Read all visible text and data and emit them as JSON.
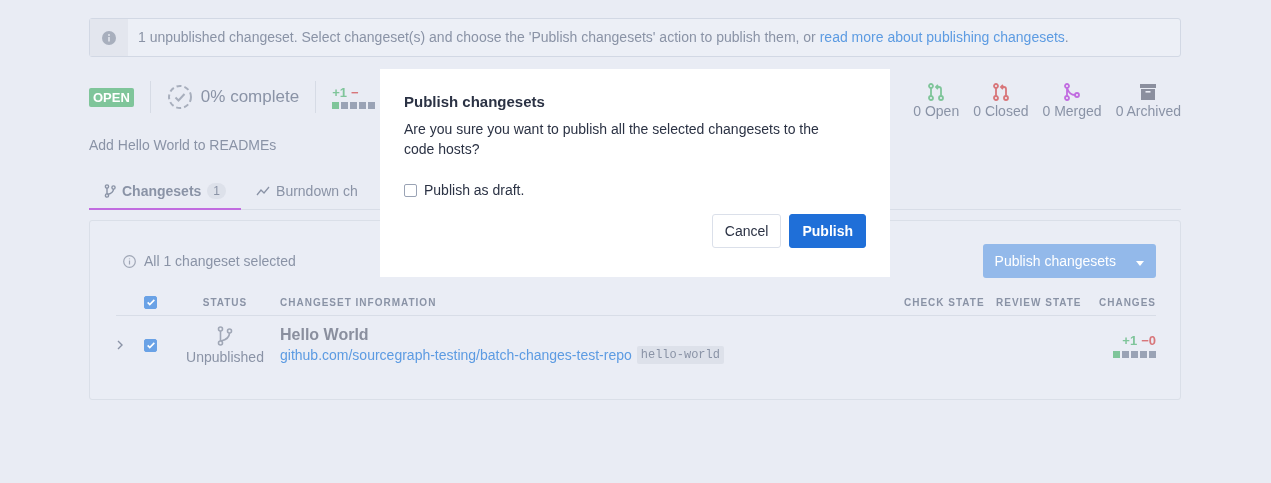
{
  "banner": {
    "text": "1 unpublished changeset. Select changeset(s) and choose the 'Publish changesets' action to publish them, or ",
    "link": "read more about publishing changesets",
    "end": "."
  },
  "stats": {
    "state_badge": "OPEN",
    "progress": "0% complete",
    "diff": {
      "added": "+1",
      "removed": "−"
    },
    "counts": [
      {
        "kind": "open",
        "label": "0 Open"
      },
      {
        "kind": "closed",
        "label": "0 Closed"
      },
      {
        "kind": "merged",
        "label": "0 Merged"
      },
      {
        "kind": "archived",
        "label": "0 Archived"
      }
    ]
  },
  "description": "Add Hello World to READMEs",
  "tabs": [
    {
      "kind": "changesets",
      "label": "Changesets",
      "count": "1",
      "selected": true
    },
    {
      "kind": "chart",
      "label": "Burndown ch",
      "selected": false
    }
  ],
  "panel": {
    "selection_note": "All 1 changeset selected",
    "action_button": {
      "label": "Publish changesets",
      "disabled": true
    },
    "table": {
      "select_all_checked": true,
      "columns": [
        "STATUS",
        "CHANGESET INFORMATION",
        "CHECK STATE",
        "REVIEW STATE",
        "CHANGES"
      ],
      "rows": [
        {
          "expanded": false,
          "checked": true,
          "status": "Unpublished",
          "title": "Hello World",
          "repo": "github.com/sourcegraph-testing/batch-changes-test-repo",
          "branch": "hello-world",
          "added": "+1",
          "removed": "−0"
        }
      ]
    }
  },
  "dialog": {
    "title": "Publish changesets",
    "message": "Are you sure you want to publish all the selected changesets to the code hosts?",
    "checkbox": {
      "label": "Publish as draft.",
      "checked": false
    },
    "buttons": [
      {
        "kind": "secondary",
        "label": "Cancel"
      },
      {
        "kind": "primary",
        "label": "Publish"
      }
    ]
  }
}
